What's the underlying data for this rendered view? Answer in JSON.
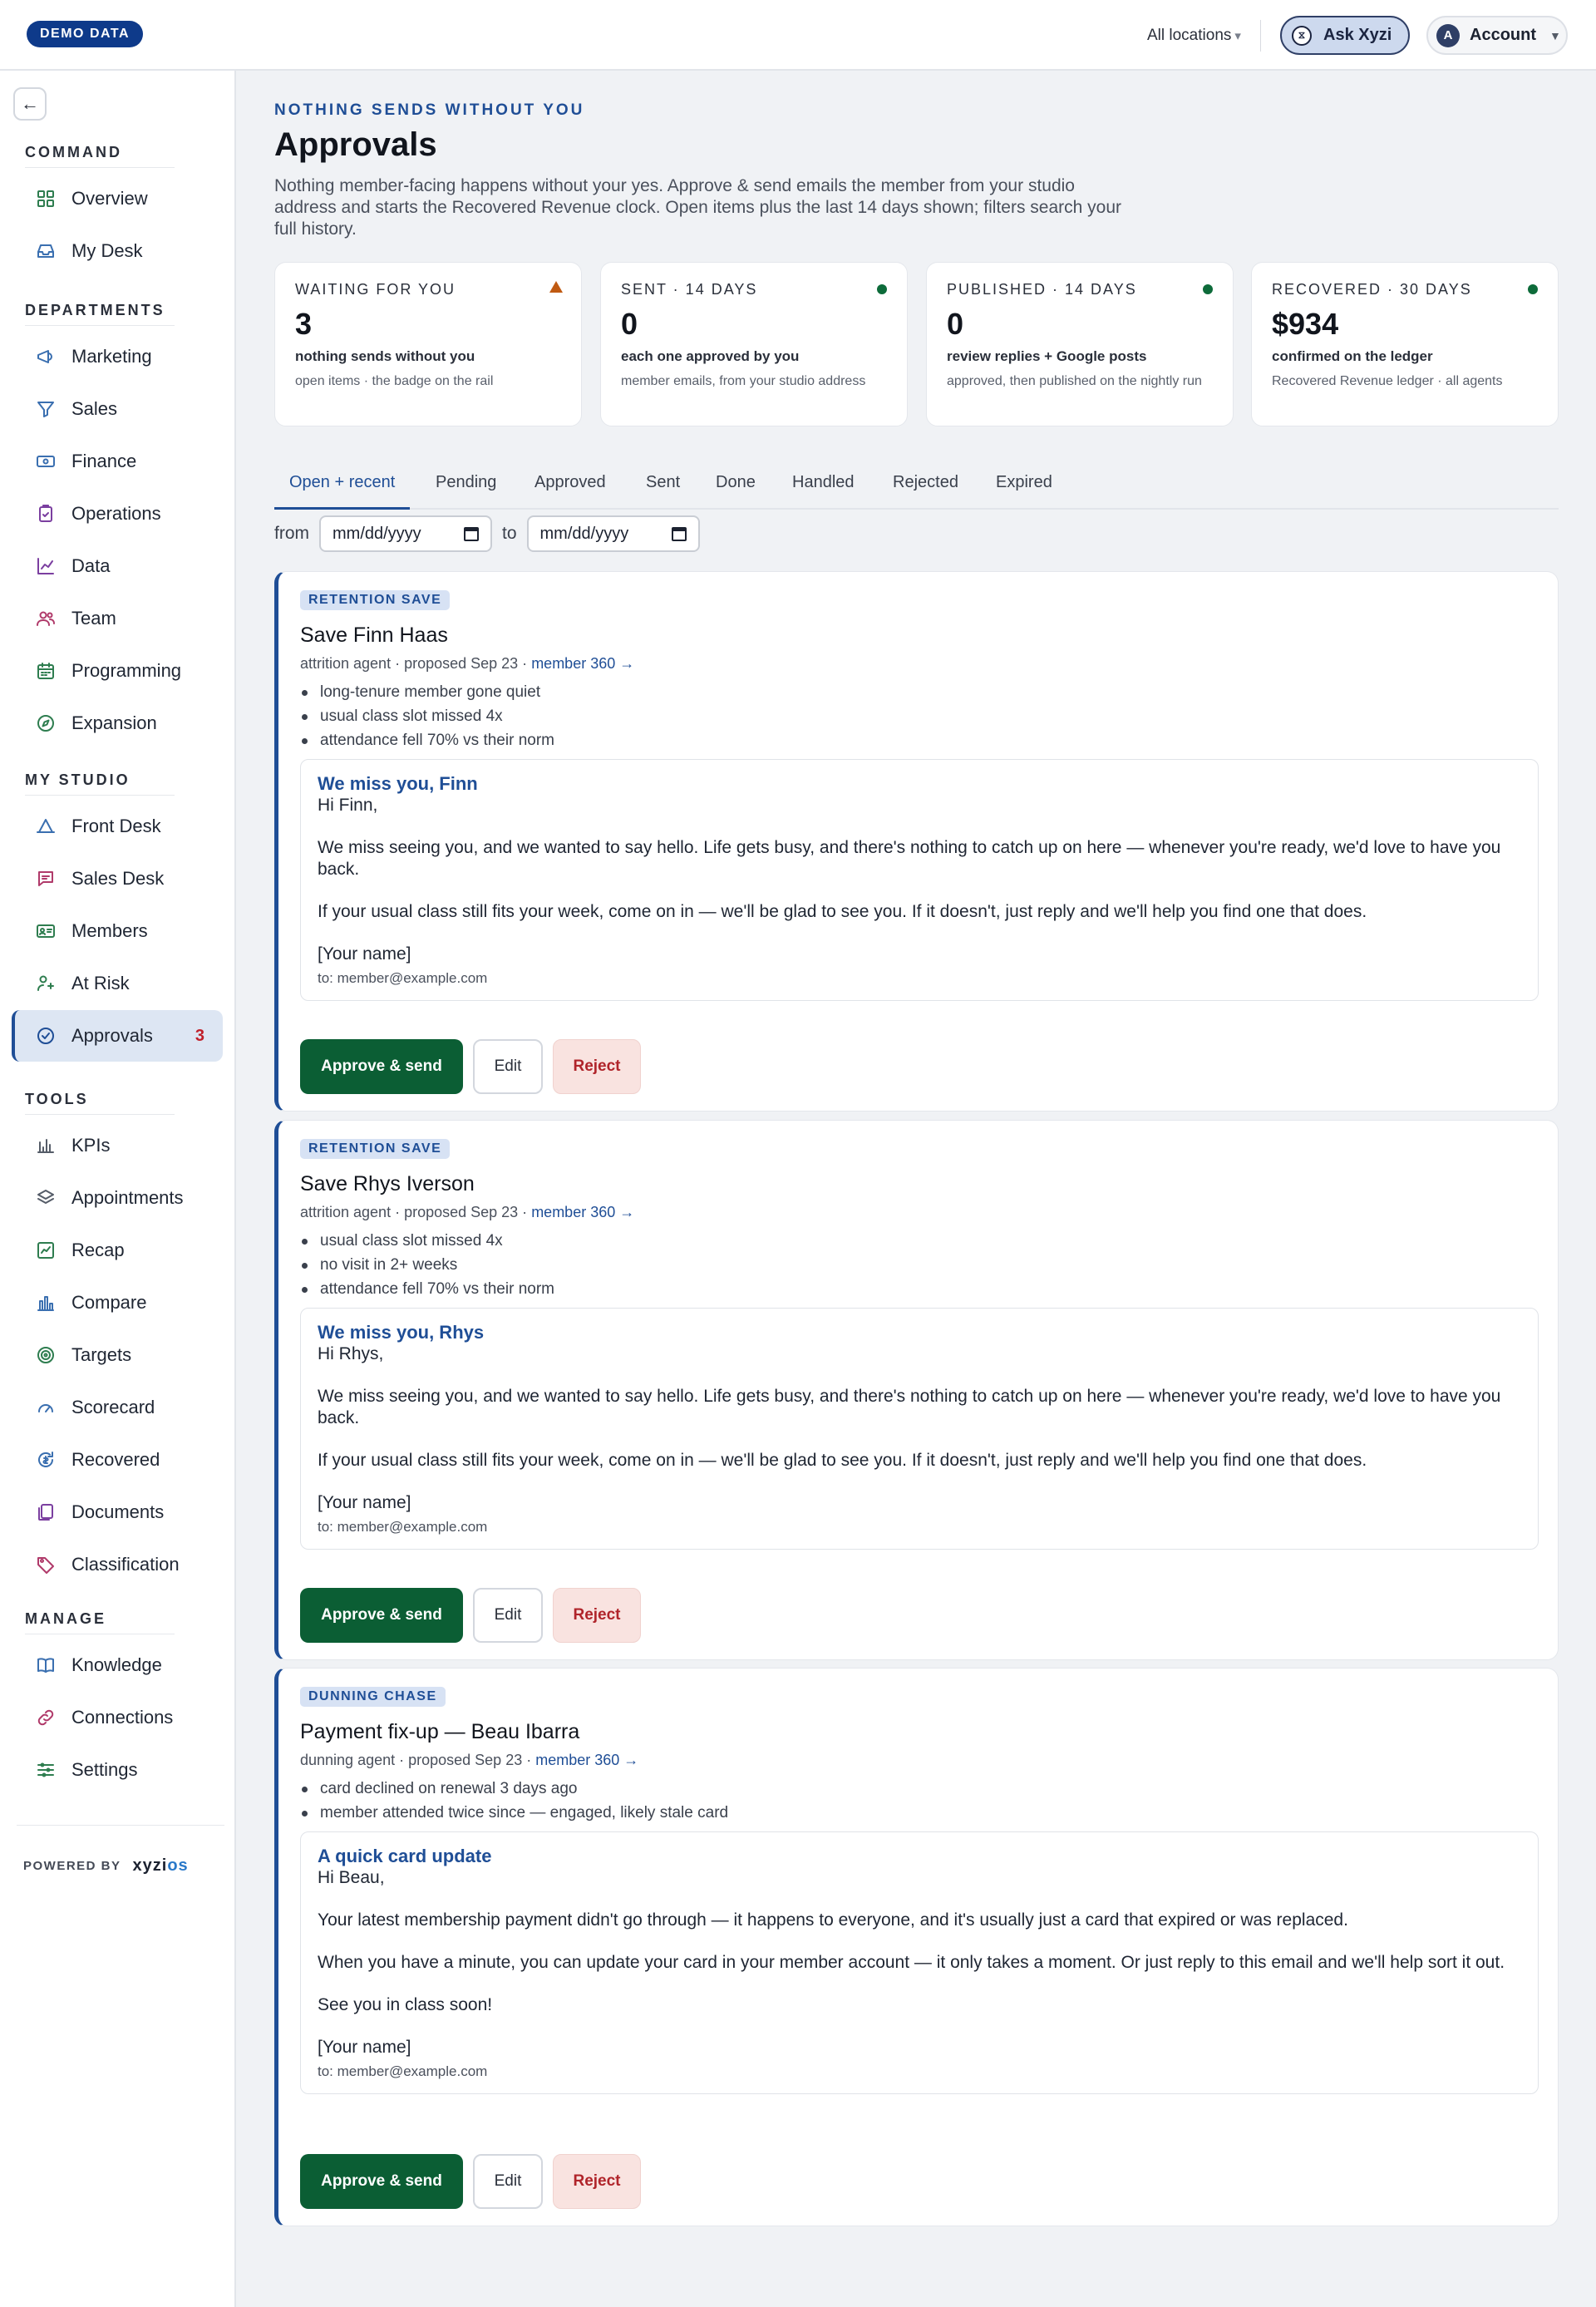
{
  "topbar": {
    "demo_badge": "DEMO DATA",
    "location": "All locations",
    "ask_label": "Ask Xyzi",
    "account_initial": "A",
    "account_label": "Account"
  },
  "sidebar": {
    "sections": [
      {
        "label": "COMMAND",
        "items": [
          {
            "label": "Overview",
            "icon": "grid-icon"
          },
          {
            "label": "My Desk",
            "icon": "inbox-icon"
          }
        ]
      },
      {
        "label": "DEPARTMENTS",
        "items": [
          {
            "label": "Marketing",
            "icon": "megaphone-icon"
          },
          {
            "label": "Sales",
            "icon": "funnel-icon"
          },
          {
            "label": "Finance",
            "icon": "banknote-icon"
          },
          {
            "label": "Operations",
            "icon": "clipboard-icon"
          },
          {
            "label": "Data",
            "icon": "line-chart-icon"
          },
          {
            "label": "Team",
            "icon": "users-icon"
          },
          {
            "label": "Programming",
            "icon": "calendar-icon"
          },
          {
            "label": "Expansion",
            "icon": "compass-icon"
          }
        ]
      },
      {
        "label": "MY STUDIO",
        "items": [
          {
            "label": "Front Desk",
            "icon": "bell-icon"
          },
          {
            "label": "Sales Desk",
            "icon": "chat-icon"
          },
          {
            "label": "Members",
            "icon": "id-card-icon"
          },
          {
            "label": "At Risk",
            "icon": "user-alert-icon"
          },
          {
            "label": "Approvals",
            "icon": "check-circle-icon",
            "count": "3",
            "active": true
          }
        ]
      },
      {
        "label": "TOOLS",
        "items": [
          {
            "label": "KPIs",
            "icon": "kpi-icon"
          },
          {
            "label": "Appointments",
            "icon": "layers-icon"
          },
          {
            "label": "Recap",
            "icon": "recap-icon"
          },
          {
            "label": "Compare",
            "icon": "bar-chart-icon"
          },
          {
            "label": "Targets",
            "icon": "target-icon"
          },
          {
            "label": "Scorecard",
            "icon": "gauge-icon"
          },
          {
            "label": "Recovered",
            "icon": "recovered-icon"
          },
          {
            "label": "Documents",
            "icon": "documents-icon"
          },
          {
            "label": "Classification",
            "icon": "tag-icon"
          }
        ]
      },
      {
        "label": "MANAGE",
        "items": [
          {
            "label": "Knowledge",
            "icon": "book-icon"
          },
          {
            "label": "Connections",
            "icon": "link-icon"
          },
          {
            "label": "Settings",
            "icon": "sliders-icon"
          }
        ]
      }
    ],
    "powered_by": "POWERED BY",
    "logo_main": "xyzi",
    "logo_accent": "os"
  },
  "page": {
    "eyebrow": "NOTHING SENDS WITHOUT YOU",
    "title": "Approvals",
    "intro": "Nothing member-facing happens without your yes. Approve & send emails the member from your studio address and starts the Recovered Revenue clock. Open items plus the last 14 days shown; filters search your full history."
  },
  "stats": [
    {
      "label": "WAITING FOR YOU",
      "value": "3",
      "sub": "nothing sends without you",
      "note": "open items · the badge on the rail",
      "marker": "warning",
      "color": "#c05a12"
    },
    {
      "label": "SENT · 14 DAYS",
      "value": "0",
      "sub": "each one approved by you",
      "note": "member emails, from your studio address",
      "marker": "dot",
      "color": "#0d6b3a"
    },
    {
      "label": "PUBLISHED · 14 DAYS",
      "value": "0",
      "sub": "review replies + Google posts",
      "note": "approved, then published on the nightly run",
      "marker": "dot",
      "color": "#0d6b3a"
    },
    {
      "label": "RECOVERED · 30 DAYS",
      "value": "$934",
      "sub": "confirmed on the ledger",
      "note": "Recovered Revenue ledger · all agents",
      "marker": "dot",
      "color": "#0d6b3a"
    }
  ],
  "tabs": [
    "Open + recent",
    "Pending",
    "Approved",
    "Sent",
    "Done",
    "Handled",
    "Rejected",
    "Expired"
  ],
  "filter": {
    "from_label": "from",
    "to_label": "to",
    "from_value": "mm/dd/yyyy",
    "to_value": "mm/dd/yyyy"
  },
  "cards": [
    {
      "tag": "RETENTION SAVE",
      "title": "Save Finn Haas",
      "meta": "attrition agent · proposed Sep 23 · ",
      "link": "member 360 →",
      "signals": [
        "long-tenure member gone quiet",
        "usual class slot missed 4x",
        "attendance fell 70% vs their norm"
      ],
      "subject": "We miss you, Finn",
      "greeting": "Hi Finn,",
      "paragraphs": [
        "We miss seeing you, and we wanted to say hello. Life gets busy, and there's nothing to catch up on here — whenever you're ready, we'd love to have you back.",
        "If your usual class still fits your week, come on in — we'll be glad to see you. If it doesn't, just reply and we'll help you find one that does."
      ],
      "signature": "[Your name]",
      "to": "to: member@example.com",
      "approve": "Approve & send",
      "edit": "Edit",
      "reject": "Reject"
    },
    {
      "tag": "RETENTION SAVE",
      "title": "Save Rhys Iverson",
      "meta": "attrition agent · proposed Sep 23 · ",
      "link": "member 360 →",
      "signals": [
        "usual class slot missed 4x",
        "no visit in 2+ weeks",
        "attendance fell 70% vs their norm"
      ],
      "subject": "We miss you, Rhys",
      "greeting": "Hi Rhys,",
      "paragraphs": [
        "We miss seeing you, and we wanted to say hello. Life gets busy, and there's nothing to catch up on here — whenever you're ready, we'd love to have you back.",
        "If your usual class still fits your week, come on in — we'll be glad to see you. If it doesn't, just reply and we'll help you find one that does."
      ],
      "signature": "[Your name]",
      "to": "to: member@example.com",
      "approve": "Approve & send",
      "edit": "Edit",
      "reject": "Reject"
    },
    {
      "tag": "DUNNING CHASE",
      "title": "Payment fix-up — Beau Ibarra",
      "meta": "dunning agent · proposed Sep 23 · ",
      "link": "member 360 →",
      "signals": [
        "card declined on renewal 3 days ago",
        "member attended twice since — engaged, likely stale card"
      ],
      "subject": "A quick card update",
      "greeting": "Hi Beau,",
      "paragraphs": [
        "Your latest membership payment didn't go through — it happens to everyone, and it's usually just a card that expired or was replaced.",
        "When you have a minute, you can update your card in your member account — it only takes a moment. Or just reply to this email and we'll help sort it out.",
        "See you in class soon!"
      ],
      "signature": "[Your name]",
      "to": "to: member@example.com",
      "approve": "Approve & send",
      "edit": "Edit",
      "reject": "Reject"
    }
  ]
}
